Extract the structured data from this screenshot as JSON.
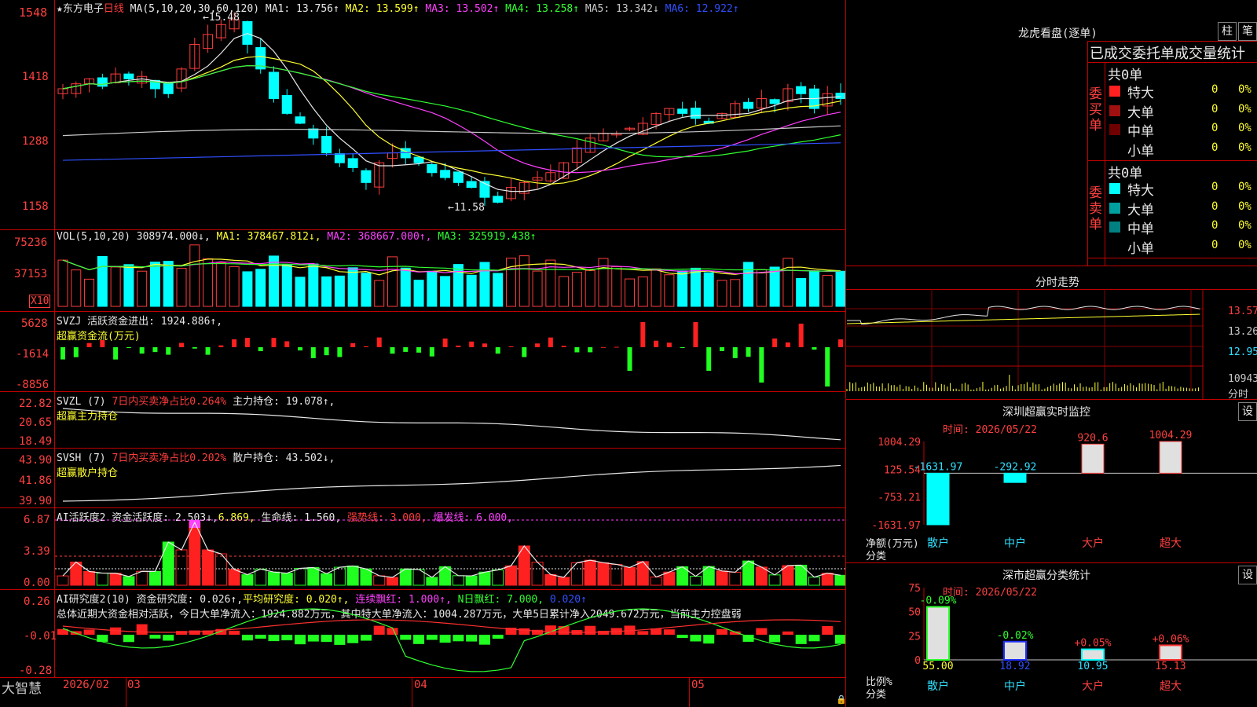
{
  "stock": {
    "name": "★东方电子",
    "period": "日线"
  },
  "ma_bar": {
    "params": "MA(5,10,20,30,60,120)",
    "items": [
      {
        "label": "MA1: 13.756↑",
        "color": "#e8e8e8"
      },
      {
        "label": "MA2: 13.599↑",
        "color": "#ffff30"
      },
      {
        "label": "MA3: 13.502↑",
        "color": "#ff40ff"
      },
      {
        "label": "MA4: 13.258↑",
        "color": "#30ff30"
      },
      {
        "label": "MA5: 13.342↓",
        "color": "#c8c8c8"
      },
      {
        "label": "MA6: 12.922↑",
        "color": "#3050ff"
      }
    ]
  },
  "price_axis": [
    "1548",
    "1418",
    "1288",
    "1158"
  ],
  "price_marks": {
    "high": "15.48",
    "low": "11.58"
  },
  "vol_bar": {
    "label": "VOL(5,10,20)",
    "value": "308974.000↓,",
    "ma1": "MA1: 378467.812↓,",
    "ma2": "MA2: 368667.000↑,",
    "ma3": "MA3: 325919.438↑"
  },
  "vol_axis": [
    "75236",
    "37153",
    "X10"
  ],
  "svzj": {
    "label": "SVZJ  活跃资金进出: 1924.886↑,",
    "title": "超赢资金流(万元)",
    "axis": [
      "5628",
      "-1614",
      "-8856"
    ]
  },
  "svzl": {
    "label": "SVZL (7) ",
    "rate": "7日内买卖净占比0.264%",
    "hold": "主力持仓: 19.078↑,",
    "title": "超赢主力持仓",
    "axis": [
      "22.82",
      "20.65",
      "18.49"
    ]
  },
  "svsh": {
    "label": "SVSH (7) ",
    "rate": "7日内买卖净占比0.202%",
    "hold": "散户持仓: 43.502↓,",
    "title": "超赢散户持仓",
    "axis": [
      "43.90",
      "41.86",
      "39.90"
    ]
  },
  "ai_active": {
    "label": "AI活跃度2 资金活跃度: 2.503↓,",
    "v2": "6.869,",
    "life": "生命线: 1.560,",
    "strong": "强势线: 3.000,",
    "burst": "爆发线: 6.000,",
    "axis": [
      "6.87",
      "3.39",
      "0.00"
    ]
  },
  "ai_research": {
    "label": "AI研究度2(10) 资金研究度: 0.026↑,",
    "avg": "平均研究度: 0.020↑,",
    "cont": "连续飘红: 1.000↑,",
    "nday": "N日飘红: 7.000,",
    "last": "0.020↑",
    "summary": "总体近期大资金相对活跃，今日大单净流入：1924.882万元，其中特大单净流入：1004.287万元，大单5日累计净入2049.672万元，当前主力控盘弱",
    "axis": [
      "0.26",
      "-0.01",
      "-0.28"
    ]
  },
  "bottom_bar": {
    "brand": "大智慧",
    "date_start": "2026/02",
    "m03": "03",
    "m04": "04",
    "m05": "05"
  },
  "lhb": {
    "title": "龙虎看盘(逐单)",
    "btn_zhu": "柱",
    "btn_bi": "笔",
    "tabs": "已成交委托单成交量统计",
    "buy_total": "共0单",
    "sell_total": "共0单",
    "buy_side": "委买单",
    "sell_side": "委卖单",
    "buy_rows": [
      {
        "label": "特大",
        "n": "0",
        "p": "0%",
        "color": "#ff2020"
      },
      {
        "label": "大单",
        "n": "0",
        "p": "0%",
        "color": "#a01010"
      },
      {
        "label": "中单",
        "n": "0",
        "p": "0%",
        "color": "#700000"
      },
      {
        "label": "小单",
        "n": "0",
        "p": "0%",
        "color": ""
      }
    ],
    "sell_rows": [
      {
        "label": "特大",
        "n": "0",
        "p": "0%",
        "color": "#00ffff"
      },
      {
        "label": "大单",
        "n": "0",
        "p": "0%",
        "color": "#00a0a0"
      },
      {
        "label": "中单",
        "n": "0",
        "p": "0%",
        "color": "#008080"
      },
      {
        "label": "小单",
        "n": "0",
        "p": "0%",
        "color": ""
      }
    ]
  },
  "intraday": {
    "title": "分时走势",
    "axis": [
      "13.57",
      "13.26",
      "12.95",
      "10943"
    ],
    "unit": "分时"
  },
  "sz_monitor": {
    "title": "深圳超赢实时监控",
    "btn": "设",
    "time": "时间: 2026/05/22",
    "axis": [
      "1004.29",
      "125.54",
      "-753.21",
      "-1631.97"
    ],
    "bars": [
      {
        "cat": "散户",
        "value": -1631.97,
        "label": "-1631.97"
      },
      {
        "cat": "中户",
        "value": -292.92,
        "label": "-292.92"
      },
      {
        "cat": "大户",
        "value": 920.6,
        "label": "920.6"
      },
      {
        "cat": "超大",
        "value": 1004.29,
        "label": "1004.29"
      }
    ],
    "ylabel": "净额(万元)",
    "xlabel": "分类"
  },
  "sz_class": {
    "title": "深市超赢分类统计",
    "btn": "设",
    "time": "时间: 2026/05/22",
    "axis": [
      "75",
      "50",
      "25",
      "0"
    ],
    "bars": [
      {
        "cat": "散户",
        "value": 55.0,
        "label": "55.00",
        "chg": "-0.09%"
      },
      {
        "cat": "中户",
        "value": 18.92,
        "label": "18.92",
        "chg": "-0.02%"
      },
      {
        "cat": "大户",
        "value": 10.95,
        "label": "10.95",
        "chg": "+0.05%"
      },
      {
        "cat": "超大",
        "value": 15.13,
        "label": "15.13",
        "chg": "+0.06%"
      }
    ],
    "ylabel": "比例%",
    "xlabel": "分类"
  }
}
